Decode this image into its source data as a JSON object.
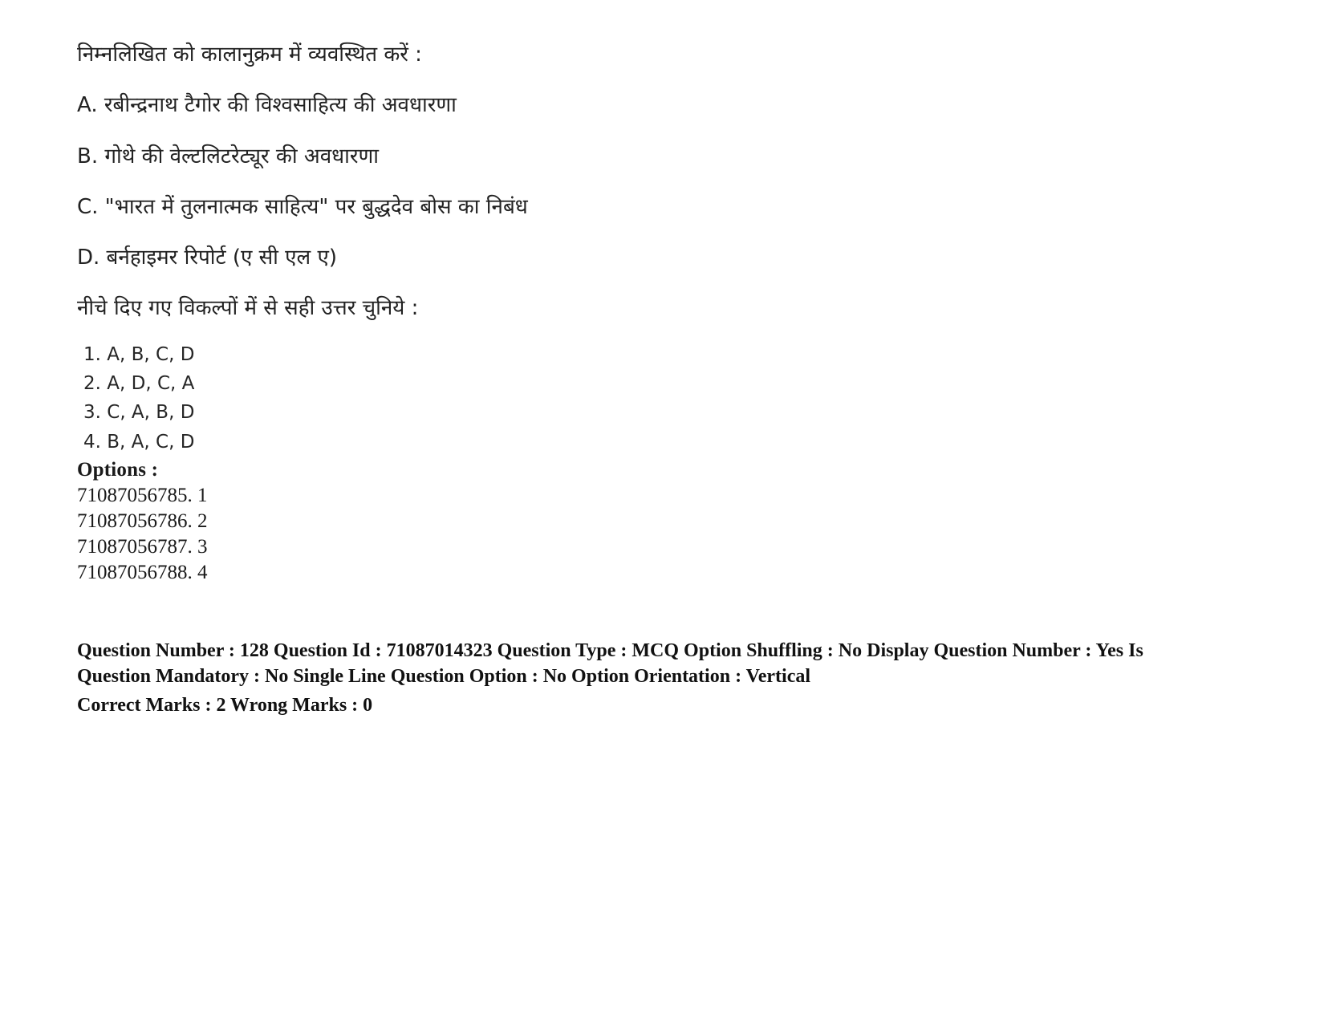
{
  "question": {
    "stem": "निम्नलिखित को कालानुक्रम में व्यवस्थित करें :",
    "statements": [
      "A. रबीन्द्रनाथ टैगोर की विश्वसाहित्य की अवधारणा",
      "B. गोथे की वेल्टलिटरेट्यूर की अवधारणा",
      "C. \"भारत में तुलनात्मक साहित्य\" पर बुद्धदेव बोस का निबंध",
      "D. बर्नहाइमर रिपोर्ट (ए सी एल ए)"
    ],
    "instruction": "नीचे दिए गए विकल्पों में से सही उत्तर चुनिये :",
    "choices": [
      "1. A, B, C, D",
      "2. A, D, C, A",
      "3. C, A, B, D",
      "4. B, A, C, D"
    ]
  },
  "options_block": {
    "heading": "Options :",
    "entries": [
      "71087056785. 1",
      "71087056786. 2",
      "71087056787. 3",
      "71087056788. 4"
    ]
  },
  "metadata": {
    "line1": "Question Number : 128 Question Id : 71087014323 Question Type : MCQ Option Shuffling : No Display Question Number : Yes Is Question Mandatory : No Single Line Question Option : No Option Orientation : Vertical",
    "line2": "Correct Marks : 2 Wrong Marks : 0",
    "fields": {
      "question_number": "128",
      "question_id": "71087014323",
      "question_type": "MCQ",
      "option_shuffling": "No",
      "display_question_number": "Yes",
      "is_question_mandatory": "No",
      "single_line_question_option": "No",
      "option_orientation": "Vertical",
      "correct_marks": "2",
      "wrong_marks": "0"
    }
  }
}
